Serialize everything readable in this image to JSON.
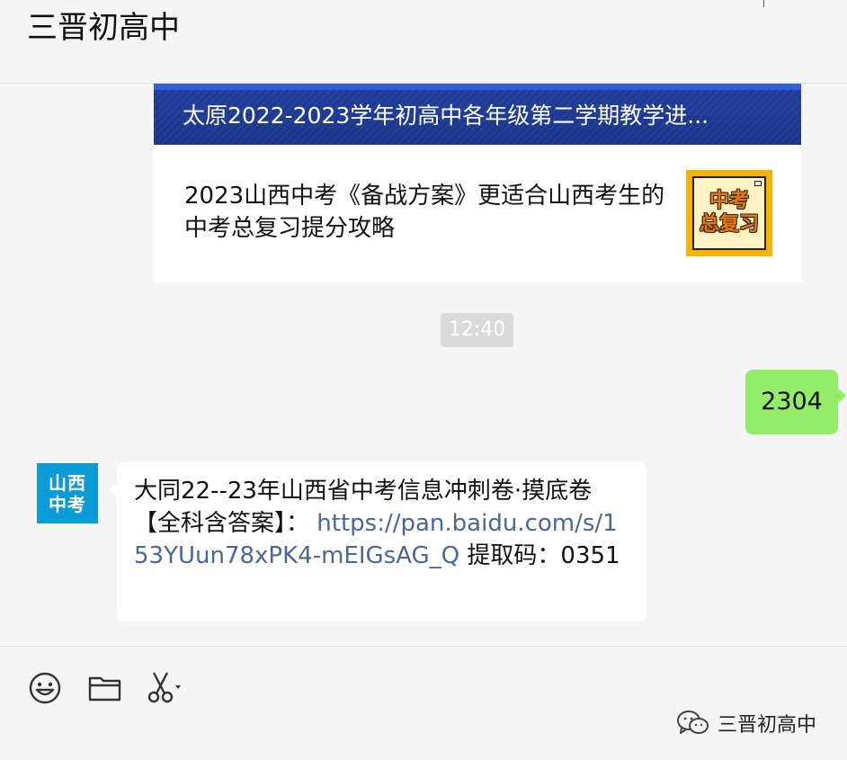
{
  "header": {
    "title": "三晋初高中"
  },
  "article": {
    "banner_title": "太原2022-2023学年初高中各年级第二学期教学进...",
    "item_text": "2023山西中考《备战方案》更适合山西考生的中考总复习提分攻略",
    "thumb_line1": "中考",
    "thumb_line2": "总复习"
  },
  "time_badge": "12:40",
  "outgoing": {
    "text": "2304"
  },
  "incoming": {
    "avatar_line1": "山西",
    "avatar_line2": "中考",
    "text_before": "大同22--23年山西省中考信息冲刺卷·摸底卷【全科含答案】：",
    "link": "https://pan.baidu.com/s/153YUun78xPK4-mEIGsAG_Q",
    "text_after": "提取码：0351"
  },
  "toolbar": {
    "icons": [
      "emoji-icon",
      "folder-icon",
      "scissors-icon"
    ]
  },
  "watermark": {
    "text": "三晋初高中"
  },
  "colors": {
    "accent_green": "#95ec69",
    "banner_blue": "#1f3d9c",
    "link_blue": "#4a6796",
    "avatar_blue": "#0b9bd7"
  }
}
